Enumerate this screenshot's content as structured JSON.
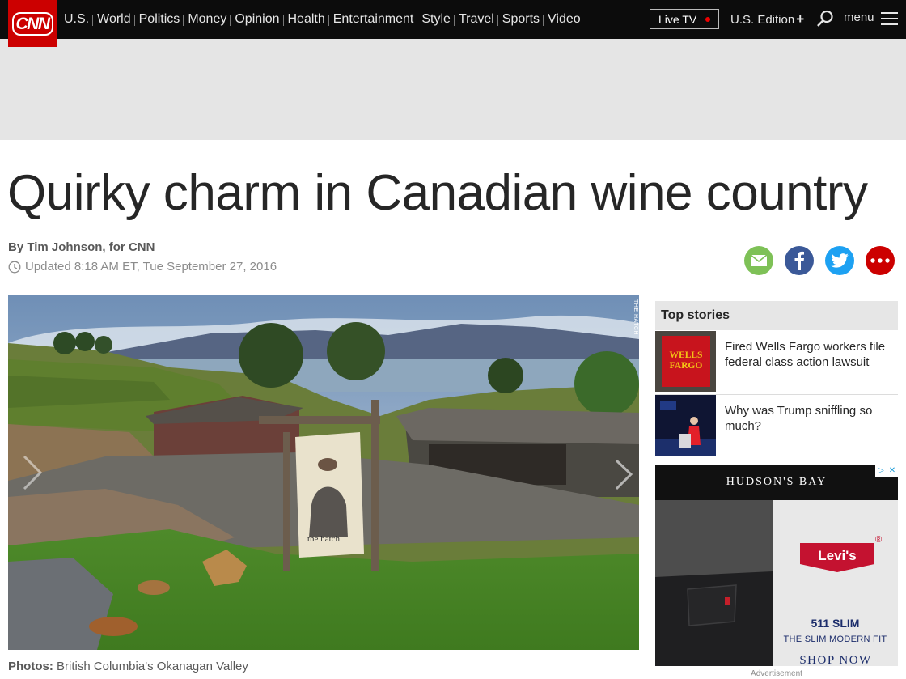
{
  "nav": {
    "logo": "CNN",
    "links": [
      "U.S.",
      "World",
      "Politics",
      "Money",
      "Opinion",
      "Health",
      "Entertainment",
      "Style",
      "Travel",
      "Sports",
      "Video"
    ],
    "live_tv": "Live TV",
    "edition": "U.S. Edition",
    "edition_plus": "+",
    "menu": "menu"
  },
  "article": {
    "headline": "Quirky charm in Canadian wine country",
    "byline": "By Tim Johnson, for CNN",
    "updated": "Updated 8:18 AM ET, Tue September 27, 2016",
    "photo_credit": "THE HATCH",
    "caption_label": "Photos:",
    "caption_text": "British Columbia's Okanagan Valley",
    "sign_text": "the hatch"
  },
  "share": {
    "icons": [
      "email-icon",
      "facebook-icon",
      "twitter-icon",
      "more-icon"
    ],
    "colors": {
      "email": "#7ec157",
      "facebook": "#3b5998",
      "twitter": "#1da1f2",
      "more": "#cc0000"
    }
  },
  "sidebar": {
    "heading": "Top stories",
    "stories": [
      {
        "title": "Fired Wells Fargo workers file federal class action lawsuit",
        "thumb_text": "WELLS FARGO"
      },
      {
        "title": "Why was Trump sniffling so much?"
      }
    ]
  },
  "ad": {
    "brand": "HUDSON'S BAY",
    "logo": "Levi's",
    "registered": "®",
    "product": "511 SLIM",
    "tagline": "THE SLIM MODERN FIT",
    "cta": "SHOP NOW",
    "choices": [
      "▷",
      "✕"
    ],
    "label": "Advertisement"
  },
  "colors": {
    "cnn_red": "#cc0000",
    "nav_bg": "#0c0c0c"
  }
}
